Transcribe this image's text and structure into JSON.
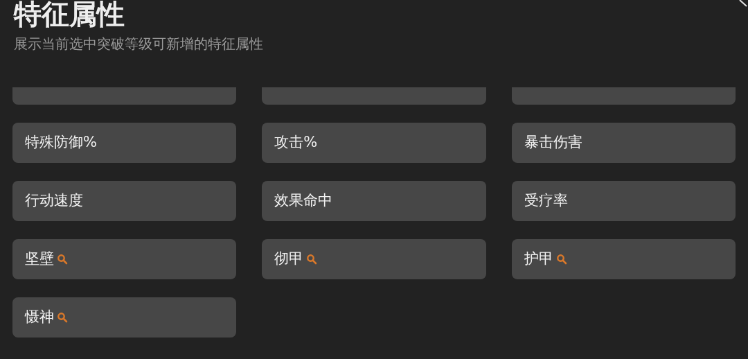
{
  "header": {
    "title": "特征属性",
    "subtitle": "展示当前选中突破等级可新增的特征属性"
  },
  "attributes": [
    {
      "label": "特殊防御%",
      "lookup": false
    },
    {
      "label": "攻击%",
      "lookup": false
    },
    {
      "label": "暴击伤害",
      "lookup": false
    },
    {
      "label": "行动速度",
      "lookup": false
    },
    {
      "label": "效果命中",
      "lookup": false
    },
    {
      "label": "受疗率",
      "lookup": false
    },
    {
      "label": "坚壁",
      "lookup": true
    },
    {
      "label": "彻甲",
      "lookup": true
    },
    {
      "label": "护甲",
      "lookup": true
    },
    {
      "label": "慑神",
      "lookup": true
    }
  ]
}
